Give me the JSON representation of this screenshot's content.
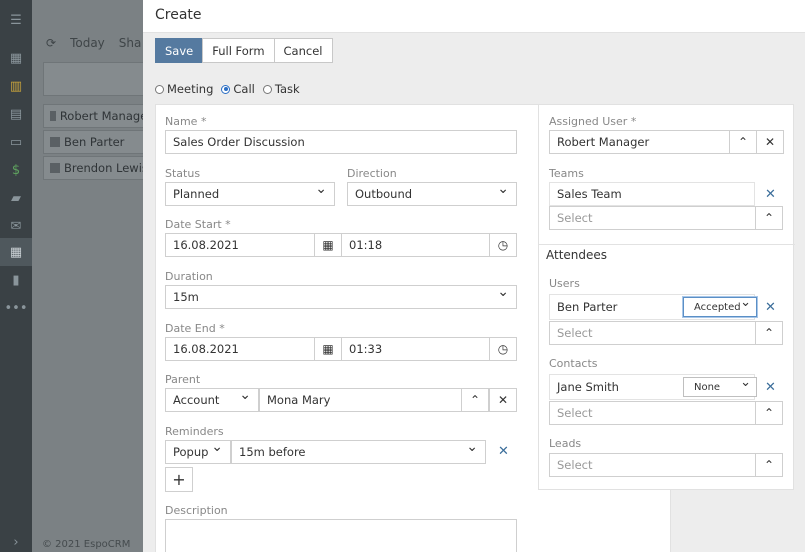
{
  "background": {
    "toolbar": {
      "today": "Today",
      "share_partial": "Sha"
    },
    "rows": [
      {
        "name": "Robert Manager"
      },
      {
        "name": "Ben Parter"
      },
      {
        "name": "Brendon Lewis"
      }
    ],
    "footer": "© 2021 EspoCRM"
  },
  "nav": {
    "icons": [
      "menu-icon",
      "dashboard-icon",
      "accounts-icon",
      "contacts-icon",
      "leads-icon",
      "opportunities-icon",
      "cases-icon",
      "email-icon",
      "calendar-icon",
      "reports-icon",
      "more-icon",
      "expand-icon"
    ]
  },
  "modal": {
    "title": "Create",
    "buttons": {
      "save": "Save",
      "full_form": "Full Form",
      "cancel": "Cancel"
    },
    "types": {
      "meeting": "Meeting",
      "call": "Call",
      "task": "Task",
      "selected": "Call"
    },
    "left": {
      "name_label": "Name *",
      "name_value": "Sales Order Discussion",
      "status_label": "Status",
      "status_value": "Planned",
      "direction_label": "Direction",
      "direction_value": "Outbound",
      "date_start_label": "Date Start *",
      "date_start_date": "16.08.2021",
      "date_start_time": "01:18",
      "duration_label": "Duration",
      "duration_value": "15m",
      "date_end_label": "Date End *",
      "date_end_date": "16.08.2021",
      "date_end_time": "01:33",
      "parent_label": "Parent",
      "parent_type": "Account",
      "parent_value": "Mona Mary",
      "reminders_label": "Reminders",
      "reminder_type": "Popup",
      "reminder_value": "15m before",
      "add_label": "+",
      "description_label": "Description"
    },
    "right": {
      "assigned_label": "Assigned User *",
      "assigned_value": "Robert Manager",
      "teams_label": "Teams",
      "team_item": "Sales Team",
      "select_placeholder": "Select",
      "attendees_heading": "Attendees",
      "users_label": "Users",
      "user_item": "Ben Parter",
      "user_status": "Accepted",
      "contacts_label": "Contacts",
      "contact_item": "Jane Smith",
      "contact_status": "None",
      "leads_label": "Leads"
    }
  }
}
